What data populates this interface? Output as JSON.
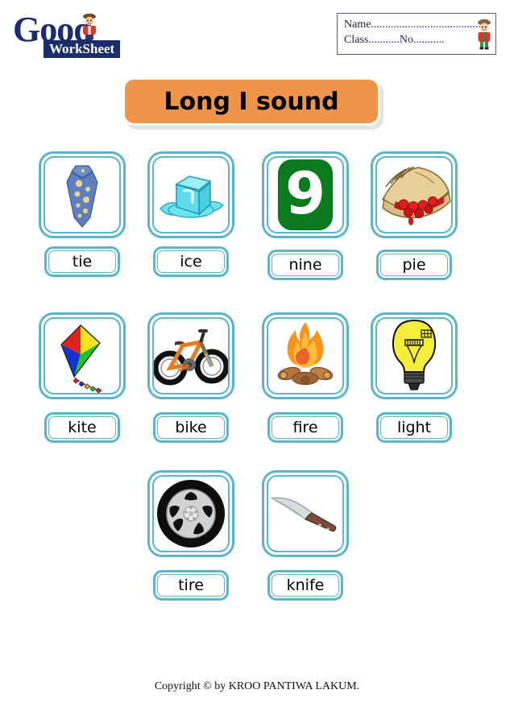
{
  "logo": {
    "word_good": "Good",
    "word_worksheet": "WorkSheet",
    "figure_icon": "teacher-figure-icon"
  },
  "name_block": {
    "name_line": "Name.........................................",
    "class_line": "Class...........No...........",
    "kid_icon": "student-figure-icon"
  },
  "title": {
    "text": "Long I sound",
    "banner_color": "#f0944a",
    "text_color": "#000000"
  },
  "style": {
    "card_border_color": "#5cb3cc",
    "page_background": "#ffffff"
  },
  "rows": [
    {
      "items": [
        {
          "label": "tie",
          "icon": "necktie-icon"
        },
        {
          "label": "ice",
          "icon": "ice-cube-icon"
        },
        {
          "label": "nine",
          "icon": "number-nine-icon"
        },
        {
          "label": "pie",
          "icon": "cherry-pie-slice-icon"
        }
      ]
    },
    {
      "items": [
        {
          "label": "kite",
          "icon": "kite-icon"
        },
        {
          "label": "bike",
          "icon": "bicycle-icon"
        },
        {
          "label": "fire",
          "icon": "campfire-icon"
        },
        {
          "label": "light",
          "icon": "light-bulb-icon"
        }
      ]
    },
    {
      "items": [
        {
          "label": "tire",
          "icon": "tire-wheel-icon"
        },
        {
          "label": "knife",
          "icon": "kitchen-knife-icon"
        }
      ]
    }
  ],
  "footer": {
    "text": "Copyright © by KROO PANTIWA LAKUM."
  }
}
